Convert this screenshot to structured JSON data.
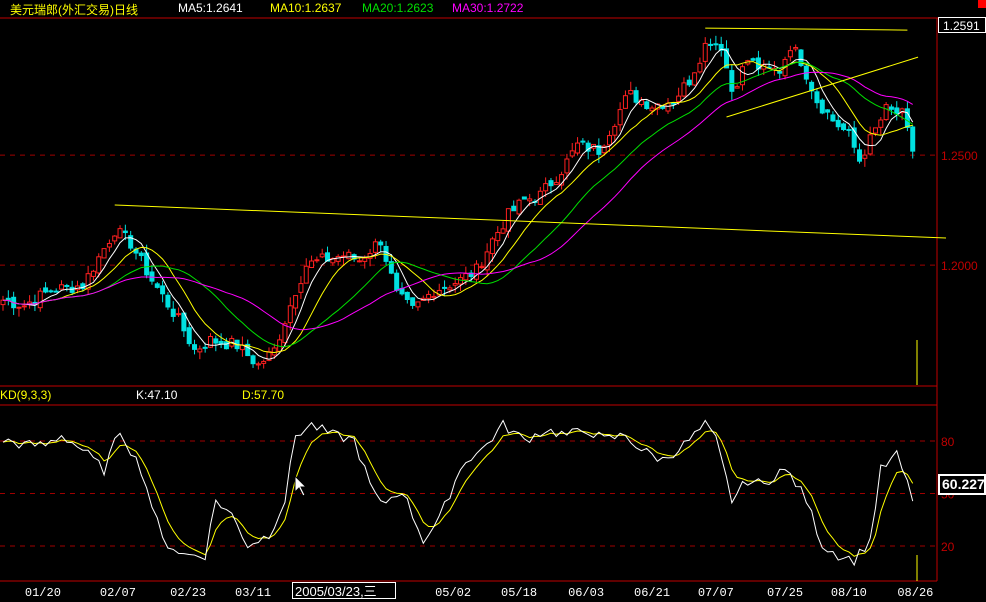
{
  "header": {
    "title": "美元瑞郎(外汇交易)日线",
    "ma5": "MA5:1.2641",
    "ma10": "MA10:1.2637",
    "ma20": "MA20:1.2623",
    "ma30": "MA30:1.2722"
  },
  "kd_header": {
    "label": "KD(9,3,3)",
    "k": "K:47.10",
    "d": "D:57.70"
  },
  "cursor_price": "1.2591",
  "cursor_kd": "60.227",
  "tooltip_date": "2005/03/23,三",
  "colors": {
    "up": "#ff2020",
    "down": "#00e0e0",
    "ma5": "#ffffff",
    "ma10": "#ffff00",
    "ma20": "#00e000",
    "ma30": "#ff00ff",
    "grid": "#a00000",
    "trend": "#ffff00"
  },
  "chart_data": [
    {
      "type": "candlestick",
      "title": "美元瑞郎(外汇交易)日线",
      "candle_count": 172,
      "ylim": [
        1.1455,
        1.3123
      ],
      "y_ticks": [
        "1.2500",
        "1.2000"
      ],
      "y_tick_values": [
        1.25,
        1.2
      ],
      "close_keypoints": [
        [
          0,
          1.1841
        ],
        [
          4,
          1.1818
        ],
        [
          9,
          1.1886
        ],
        [
          15,
          1.1909
        ],
        [
          21,
          1.2159
        ],
        [
          24,
          1.21
        ],
        [
          28,
          1.1932
        ],
        [
          33,
          1.175
        ],
        [
          36,
          1.1614
        ],
        [
          39,
          1.1659
        ],
        [
          44,
          1.1636
        ],
        [
          48,
          1.1545
        ],
        [
          51,
          1.1614
        ],
        [
          55,
          1.1886
        ],
        [
          57,
          1.2
        ],
        [
          60,
          1.2023
        ],
        [
          64,
          1.2045
        ],
        [
          67,
          1.2023
        ],
        [
          71,
          1.2114
        ],
        [
          74,
          1.1864
        ],
        [
          77,
          1.1795
        ],
        [
          81,
          1.1886
        ],
        [
          86,
          1.1932
        ],
        [
          89,
          1.1977
        ],
        [
          92,
          1.2114
        ],
        [
          95,
          1.2227
        ],
        [
          98,
          1.2295
        ],
        [
          101,
          1.2318
        ],
        [
          105,
          1.2432
        ],
        [
          108,
          1.2545
        ],
        [
          112,
          1.2523
        ],
        [
          115,
          1.2659
        ],
        [
          117,
          1.275
        ],
        [
          118,
          1.2773
        ],
        [
          122,
          1.2727
        ],
        [
          126,
          1.275
        ],
        [
          129,
          1.2841
        ],
        [
          132,
          1.3
        ],
        [
          133,
          1.3023
        ],
        [
          135,
          1.3
        ],
        [
          137,
          1.2795
        ],
        [
          140,
          1.2932
        ],
        [
          143,
          1.2886
        ],
        [
          146,
          1.2886
        ],
        [
          148,
          1.3
        ],
        [
          150,
          1.2932
        ],
        [
          153,
          1.275
        ],
        [
          156,
          1.2659
        ],
        [
          159,
          1.2591
        ],
        [
          161,
          1.2477
        ],
        [
          164,
          1.2614
        ],
        [
          166,
          1.2705
        ],
        [
          169,
          1.2682
        ],
        [
          171,
          1.2523
        ]
      ],
      "moving_averages": [
        {
          "name": "MA5",
          "period": 5
        },
        {
          "name": "MA10",
          "period": 10
        },
        {
          "name": "MA20",
          "period": 20
        },
        {
          "name": "MA30",
          "period": 30
        }
      ],
      "trend_lines": [
        {
          "from": [
            21,
            1.2273
          ],
          "to": [
            178,
            1.2123
          ]
        },
        {
          "from": [
            132,
            1.3077
          ],
          "to": [
            170,
            1.3068
          ]
        },
        {
          "from": [
            136,
            1.2673
          ],
          "to": [
            172,
            1.2945
          ]
        }
      ],
      "x_labels": [
        {
          "index": 7.5,
          "label": "01/20"
        },
        {
          "index": 21.6,
          "label": "02/07"
        },
        {
          "index": 34.8,
          "label": "02/23"
        },
        {
          "index": 47,
          "label": "03/11"
        },
        {
          "index": 84.6,
          "label": "05/02"
        },
        {
          "index": 97,
          "label": "05/18"
        },
        {
          "index": 109.6,
          "label": "06/03"
        },
        {
          "index": 122,
          "label": "06/21"
        },
        {
          "index": 134,
          "label": "07/07"
        },
        {
          "index": 147,
          "label": "07/25"
        },
        {
          "index": 159,
          "label": "08/10"
        },
        {
          "index": 171.5,
          "label": "08/26"
        }
      ]
    },
    {
      "type": "line",
      "title": "KD(9,3,3)",
      "ylim": [
        0,
        100
      ],
      "y_ticks": [
        "80",
        "50",
        "20"
      ],
      "y_tick_values": [
        80,
        50,
        20
      ],
      "k_keypoints": [
        [
          0,
          80.6
        ],
        [
          4,
          77.7
        ],
        [
          8,
          77.7
        ],
        [
          11,
          83.4
        ],
        [
          15,
          74.9
        ],
        [
          19,
          63.4
        ],
        [
          22,
          86.3
        ],
        [
          26,
          63.4
        ],
        [
          30,
          23.4
        ],
        [
          34,
          14.9
        ],
        [
          38,
          14.9
        ],
        [
          40,
          46.3
        ],
        [
          43,
          37.7
        ],
        [
          46,
          20.6
        ],
        [
          50,
          26.3
        ],
        [
          53,
          46.3
        ],
        [
          55,
          83.4
        ],
        [
          58,
          89.1
        ],
        [
          62,
          83.4
        ],
        [
          66,
          80.6
        ],
        [
          69,
          54.9
        ],
        [
          71,
          43.4
        ],
        [
          75,
          52
        ],
        [
          79,
          23.4
        ],
        [
          82,
          34.9
        ],
        [
          85,
          57.7
        ],
        [
          87,
          69.1
        ],
        [
          90,
          74.9
        ],
        [
          94,
          89.1
        ],
        [
          98,
          80.6
        ],
        [
          102,
          86.3
        ],
        [
          106,
          83.4
        ],
        [
          110,
          86.3
        ],
        [
          113,
          80.6
        ],
        [
          117,
          83.4
        ],
        [
          120,
          74.9
        ],
        [
          124,
          69.1
        ],
        [
          128,
          77.7
        ],
        [
          132,
          89.1
        ],
        [
          134,
          80.6
        ],
        [
          137,
          46.3
        ],
        [
          140,
          57.7
        ],
        [
          143,
          54.9
        ],
        [
          146,
          63.4
        ],
        [
          148,
          60.6
        ],
        [
          151,
          46.3
        ],
        [
          154,
          20.6
        ],
        [
          157,
          14.9
        ],
        [
          160,
          12
        ],
        [
          163,
          23.4
        ],
        [
          165,
          63.4
        ],
        [
          168,
          72
        ],
        [
          171,
          47.1
        ]
      ],
      "d_period": 3,
      "series": [
        {
          "name": "K"
        },
        {
          "name": "D"
        }
      ]
    }
  ]
}
